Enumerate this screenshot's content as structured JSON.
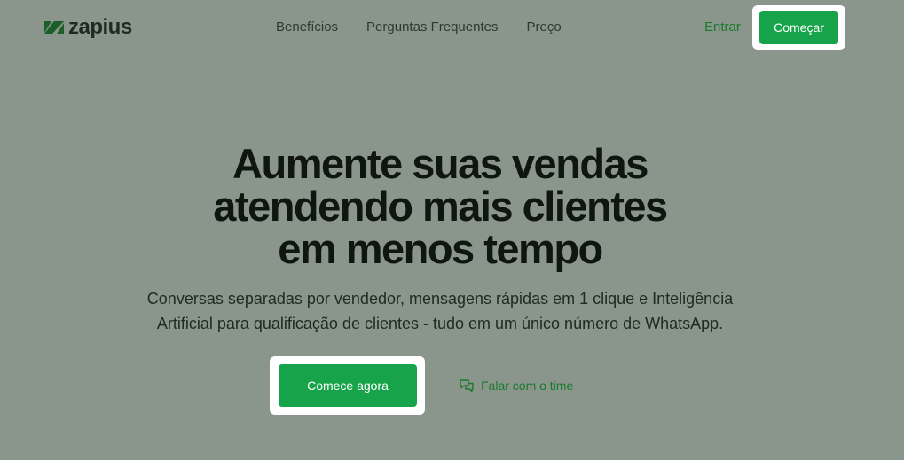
{
  "brand": {
    "name": "zapius",
    "logo_icon": "zapius-logo-icon"
  },
  "nav": {
    "links": [
      "Benefícios",
      "Perguntas Frequentes",
      "Preço"
    ],
    "login_label": "Entrar",
    "cta_label": "Começar"
  },
  "hero": {
    "title_lines": [
      "Aumente suas vendas",
      "atendendo mais clientes",
      "em menos tempo"
    ],
    "subtitle_lines": [
      "Conversas separadas por vendedor, mensagens rápidas em 1 clique e Inteligência",
      "Artificial para qualificação de clientes - tudo em um único número de WhatsApp."
    ],
    "primary_cta": "Comece agora",
    "secondary_cta": {
      "label": "Falar com o time",
      "icon": "chat-bubbles-icon"
    }
  },
  "colors": {
    "accent": "#16a34a",
    "link_green": "#1a7a2c",
    "background": "#8a958b",
    "heading": "#0f1510"
  }
}
